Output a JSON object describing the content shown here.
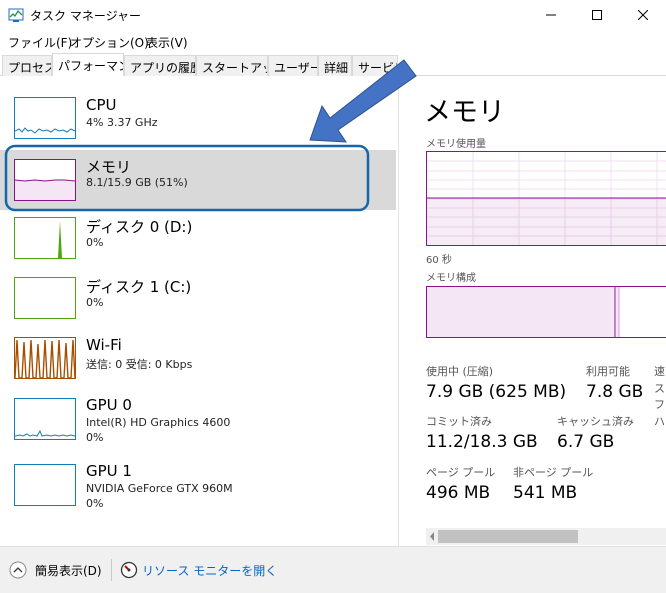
{
  "window": {
    "title": "タスク マネージャー"
  },
  "menu": [
    "ファイル(F)",
    "オプション(O)",
    "表示(V)"
  ],
  "tabs": [
    {
      "label": "プロセス",
      "active": false
    },
    {
      "label": "パフォーマンス",
      "active": true
    },
    {
      "label": "アプリの履歴",
      "active": false
    },
    {
      "label": "スタートアップ",
      "active": false
    },
    {
      "label": "ユーザー",
      "active": false
    },
    {
      "label": "詳細",
      "active": false
    },
    {
      "label": "サービス",
      "active": false
    }
  ],
  "resources": [
    {
      "name": "CPU",
      "sub": "4%  3.37 GHz",
      "sub2": ""
    },
    {
      "name": "メモリ",
      "sub": "8.1/15.9 GB (51%)",
      "sub2": "",
      "selected": true
    },
    {
      "name": "ディスク 0 (D:)",
      "sub": "0%",
      "sub2": ""
    },
    {
      "name": "ディスク 1 (C:)",
      "sub": "0%",
      "sub2": ""
    },
    {
      "name": "Wi-Fi",
      "sub": "送信: 0  受信: 0 Kbps",
      "sub2": ""
    },
    {
      "name": "GPU 0",
      "sub": "Intel(R) HD Graphics 4600",
      "sub2": "0%"
    },
    {
      "name": "GPU 1",
      "sub": "NVIDIA GeForce GTX 960M",
      "sub2": "0%"
    }
  ],
  "colors": {
    "cpu": "#117dbb",
    "memory": "#8b128b",
    "disk": "#4da60c",
    "wifi": "#a74f01",
    "gpu": "#117dbb",
    "selection_border": "#1466a8",
    "arrow": "#4472c4"
  },
  "detail": {
    "title": "メモリ",
    "usage_label": "メモリ使用量",
    "time_label": "60 秒",
    "composition_label": "メモリ構成",
    "stats": {
      "in_use_label": "使用中 (圧縮)",
      "in_use_value": "7.9 GB (625 MB)",
      "available_label": "利用可能",
      "available_value": "7.8 GB",
      "committed_label": "コミット済み",
      "committed_value": "11.2/18.3 GB",
      "cached_label": "キャッシュ済み",
      "cached_value": "6.7 GB",
      "paged_label": "ページ プール",
      "paged_value": "496 MB",
      "nonpaged_label": "非ページ プール",
      "nonpaged_value": "541 MB"
    },
    "cut_col": [
      "速",
      "ス",
      "フォ",
      "ハ"
    ]
  },
  "footer": {
    "less_details": "簡易表示(D)",
    "open_monitor": "リソース モニターを開く"
  }
}
